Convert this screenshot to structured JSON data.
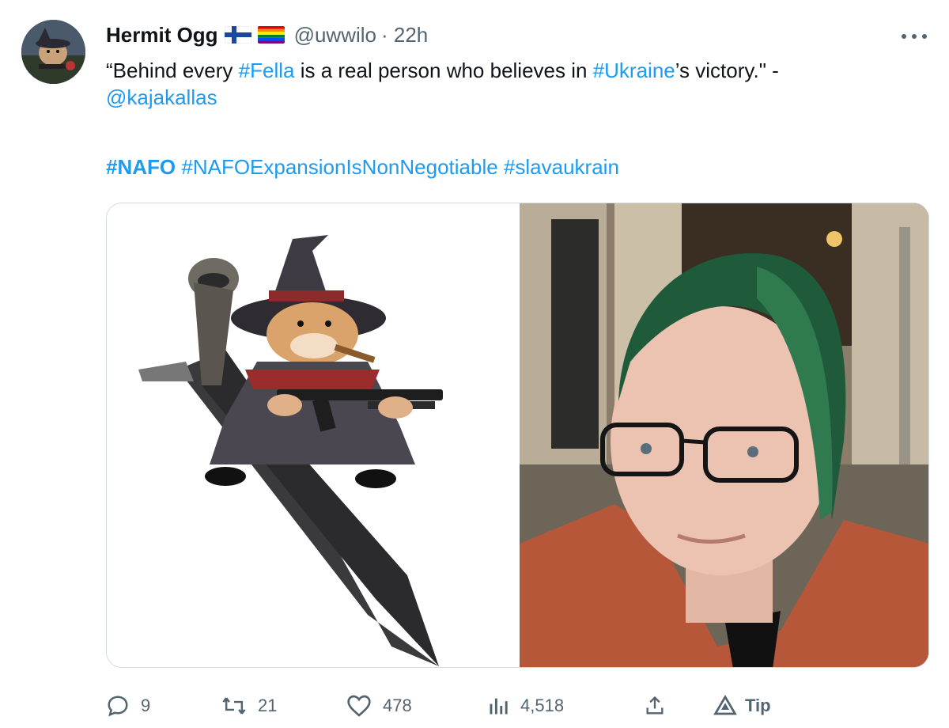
{
  "tweet": {
    "author": {
      "name": "Hermit Ogg",
      "handle": "@uwwilo",
      "time": "· 22h",
      "flags": [
        "finland-flag-icon",
        "rainbow-flag-icon"
      ]
    },
    "text": {
      "seg1": "“Behind every ",
      "tag_fella": "#Fella",
      "seg2": " is a real person who believes in ",
      "tag_ukraine": "#Ukraine",
      "seg3": "’s victory.\" -",
      "mention": "@kajakallas"
    },
    "hashtags": {
      "nafo": "#NAFO",
      "expansion": "#NAFOExpansionIsNonNegotiable",
      "slava": "#slavaukrain"
    },
    "images": [
      "nafo-fella-witch-on-missile-image",
      "person-selfie-green-hair-image"
    ],
    "actions": {
      "replies": "9",
      "reposts": "21",
      "likes": "478",
      "views": "4,518",
      "tip": "Tip"
    }
  },
  "colors": {
    "link": "#1d9bf0",
    "secondary_text": "#536471",
    "border": "#cfd9de"
  }
}
